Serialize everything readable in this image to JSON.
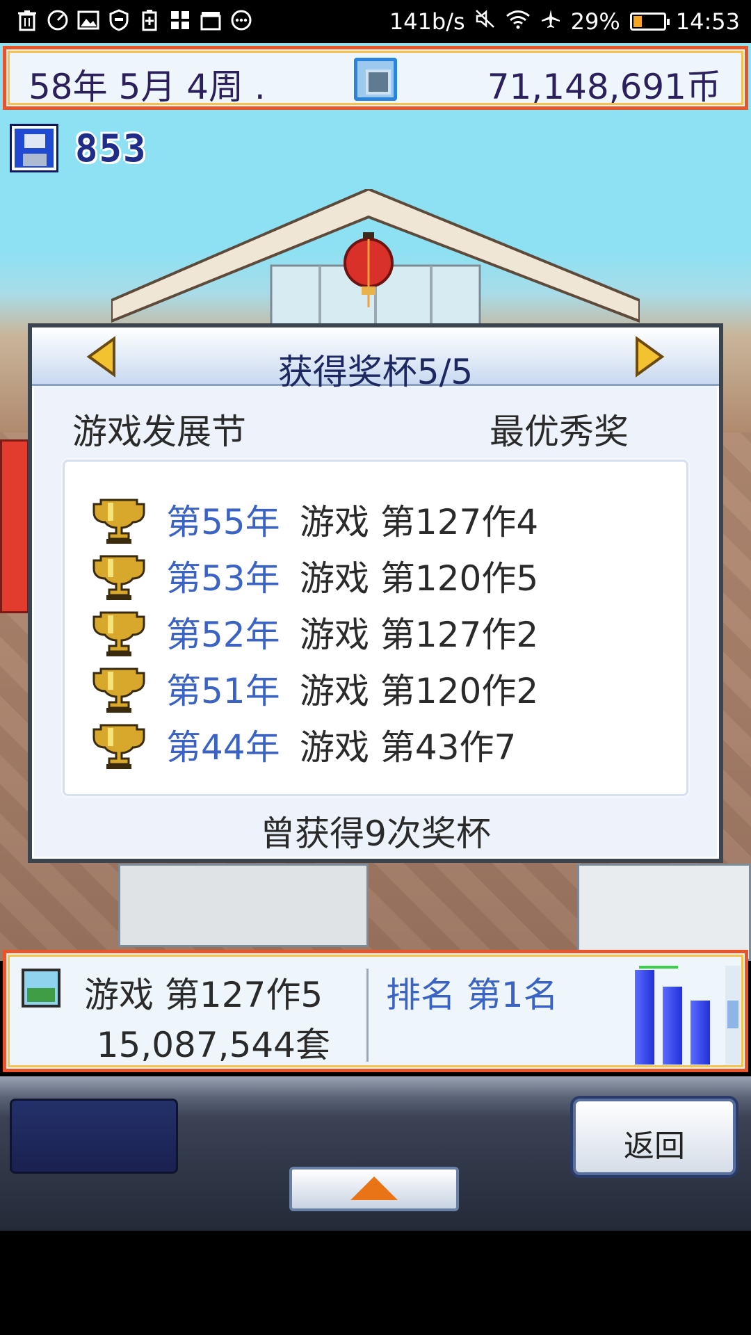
{
  "status_bar": {
    "network_speed": "141b/s",
    "battery_percent": "29%",
    "battery_level": 0.29,
    "time": "14:53",
    "left_icons": [
      "trash-icon",
      "speed-check-icon",
      "image-icon",
      "shield-icon",
      "battery-saver-icon",
      "apps-icon",
      "clapper-icon",
      "more-dots-icon"
    ],
    "right_icons": [
      "mute-icon",
      "wifi-icon",
      "airplane-icon",
      "battery-icon"
    ]
  },
  "hud_top": {
    "date": "58年 5月 4周 .",
    "money": "71,148,691币"
  },
  "research_points": "853",
  "dialog": {
    "title": "获得奖杯5/5",
    "event": "游戏发展节",
    "award": "最优秀奖",
    "trophies": [
      {
        "year": "第55年",
        "game": "游戏 第127作4"
      },
      {
        "year": "第53年",
        "game": "游戏 第120作5"
      },
      {
        "year": "第52年",
        "game": "游戏 第127作2"
      },
      {
        "year": "第51年",
        "game": "游戏 第120作2"
      },
      {
        "year": "第44年",
        "game": "游戏 第43作7"
      }
    ],
    "total": "曾获得9次奖杯"
  },
  "game_bar": {
    "title": "游戏 第127作5",
    "sales": "15,087,544套",
    "rank": "排名 第1名",
    "bar_levels": [
      1.0,
      0.82,
      0.68
    ]
  },
  "controls": {
    "back_label": "返回"
  },
  "colors": {
    "accent_orange": "#e8552a",
    "gold": "#f6c34a",
    "year_blue": "#3b63c4",
    "title_navy": "#1d2760"
  }
}
